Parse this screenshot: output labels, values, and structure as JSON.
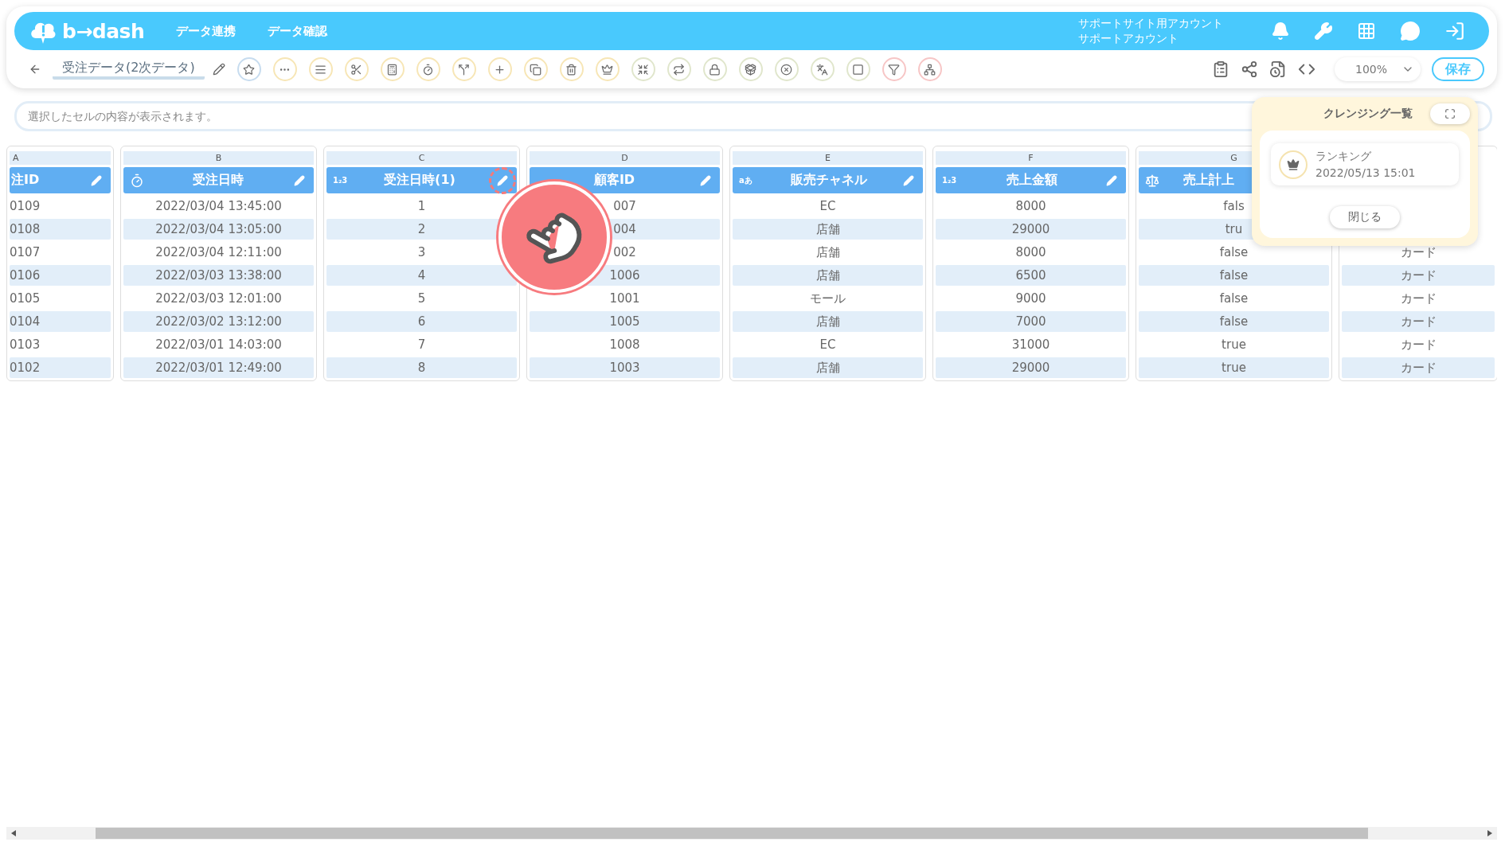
{
  "header": {
    "logo": "b→dash",
    "nav": [
      {
        "label": "データ連携"
      },
      {
        "label": "データ確認"
      }
    ],
    "account": [
      "サポートサイト用アカウント",
      "サポートアカウント"
    ]
  },
  "toolbar": {
    "title": "受注データ(2次データ)",
    "zoom": "100%",
    "save": "保存"
  },
  "cell_field": {
    "placeholder": "選択したセルの内容が表示されます。"
  },
  "columns": [
    {
      "letter": "A",
      "title": "注ID",
      "kind": "plain",
      "editable": true,
      "highlighted": false,
      "cut": true,
      "cells": [
        "0109",
        "0108",
        "0107",
        "0106",
        "0105",
        "0104",
        "0103",
        "0102"
      ]
    },
    {
      "letter": "B",
      "title": "受注日時",
      "kind": "datetime",
      "editable": true,
      "highlighted": false,
      "cut": false,
      "cells": [
        "2022/03/04 13:45:00",
        "2022/03/04 13:05:00",
        "2022/03/04 12:11:00",
        "2022/03/03 13:38:00",
        "2022/03/03 12:01:00",
        "2022/03/02 13:12:00",
        "2022/03/01 14:03:00",
        "2022/03/01 12:49:00"
      ]
    },
    {
      "letter": "C",
      "title": "受注日時(1)",
      "kind": "badge",
      "badge": "1₂3",
      "editable": true,
      "highlighted": true,
      "cut": false,
      "cells": [
        "1",
        "2",
        "3",
        "4",
        "5",
        "6",
        "7",
        "8"
      ]
    },
    {
      "letter": "D",
      "title": "顧客ID",
      "kind": "plain",
      "editable": true,
      "highlighted": false,
      "cut": false,
      "cells": [
        "007",
        "004",
        "002",
        "1006",
        "1001",
        "1005",
        "1008",
        "1003"
      ]
    },
    {
      "letter": "E",
      "title": "販売チャネル",
      "kind": "badge",
      "badge": "aあ",
      "editable": true,
      "highlighted": false,
      "cut": false,
      "cells": [
        "EC",
        "店舗",
        "店舗",
        "店舗",
        "モール",
        "店舗",
        "EC",
        "店舗"
      ]
    },
    {
      "letter": "F",
      "title": "売上金額",
      "kind": "badge",
      "badge": "1₂3",
      "editable": true,
      "highlighted": false,
      "cut": false,
      "cells": [
        "8000",
        "29000",
        "8000",
        "6500",
        "9000",
        "7000",
        "31000",
        "29000"
      ]
    },
    {
      "letter": "G",
      "title": "売上計上",
      "kind": "boolean",
      "cut": false,
      "cells": [
        "fals",
        "tru",
        "false",
        "false",
        "false",
        "false",
        "true",
        "true"
      ]
    },
    {
      "kind": "hidden",
      "cells": [
        "カード",
        "カード",
        "カード",
        "カード",
        "カード",
        "カード"
      ]
    }
  ],
  "cleansing_panel": {
    "title": "クレンジング一覧",
    "items": [
      {
        "name": "ランキング",
        "date": "2022/05/13 15:01"
      }
    ],
    "close": "閉じる"
  }
}
